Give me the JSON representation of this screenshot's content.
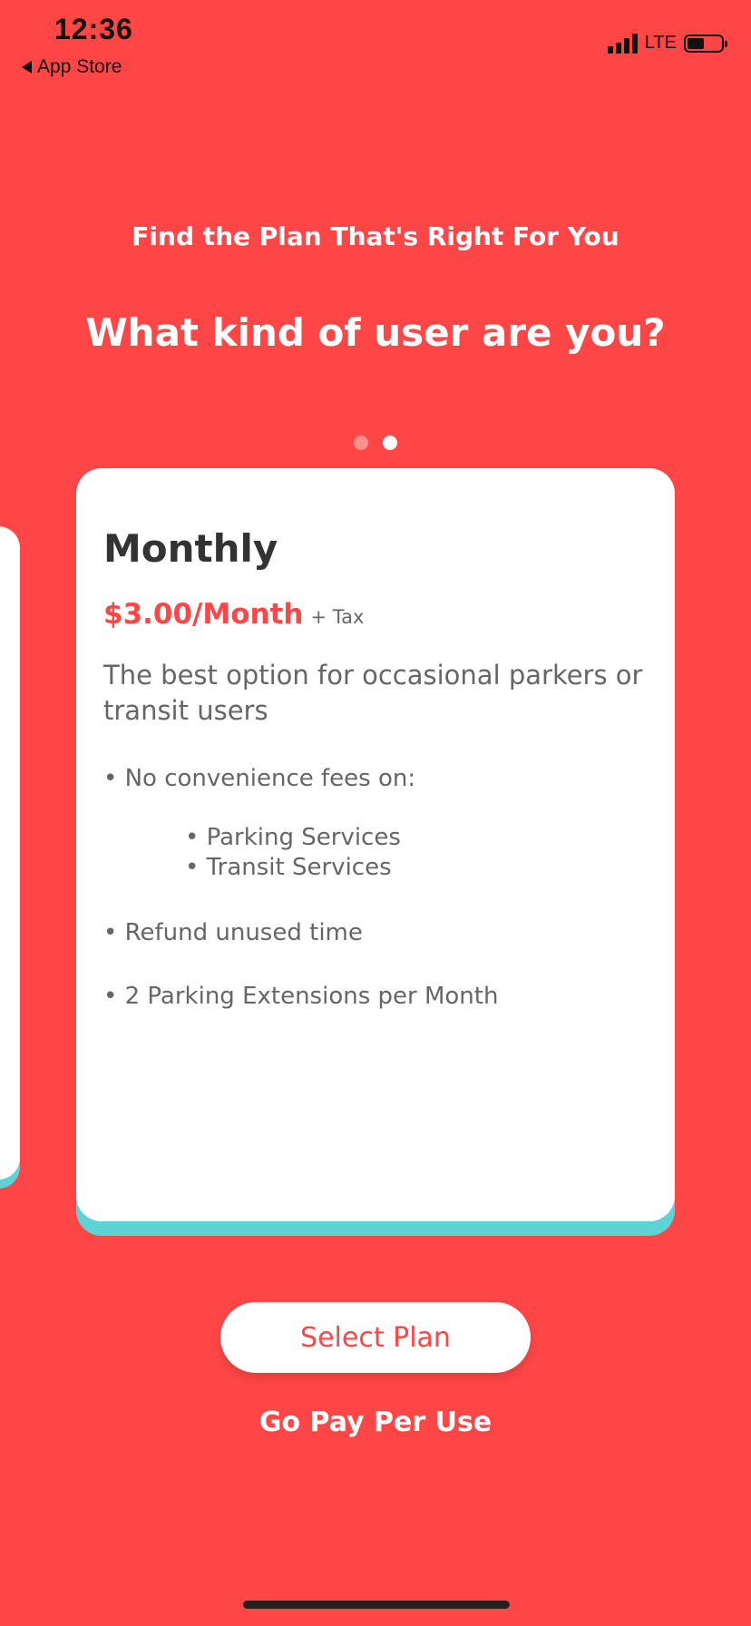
{
  "status_bar": {
    "time": "12:36",
    "back_label": "App Store",
    "network": "LTE"
  },
  "header": {
    "subtitle": "Find the Plan That's Right For You",
    "title": "What kind of user are you?"
  },
  "pager": {
    "total": 2,
    "active_index": 1
  },
  "plan": {
    "name": "Monthly",
    "price": "$3.00/Month",
    "tax_note": "+ Tax",
    "description": "The best option for occasional parkers or transit users",
    "features": {
      "no_fees": "• No convenience fees on:",
      "sub_items": [
        "• Parking Services",
        "• Transit Services"
      ],
      "refund": "• Refund unused time",
      "extensions": "• 2 Parking Extensions per Month"
    }
  },
  "actions": {
    "select_label": "Select Plan",
    "pay_per_use_label": "Go Pay Per Use"
  },
  "colors": {
    "background": "#FF4646",
    "accent_teal": "#5ED3D6",
    "card": "#FFFFFF"
  }
}
